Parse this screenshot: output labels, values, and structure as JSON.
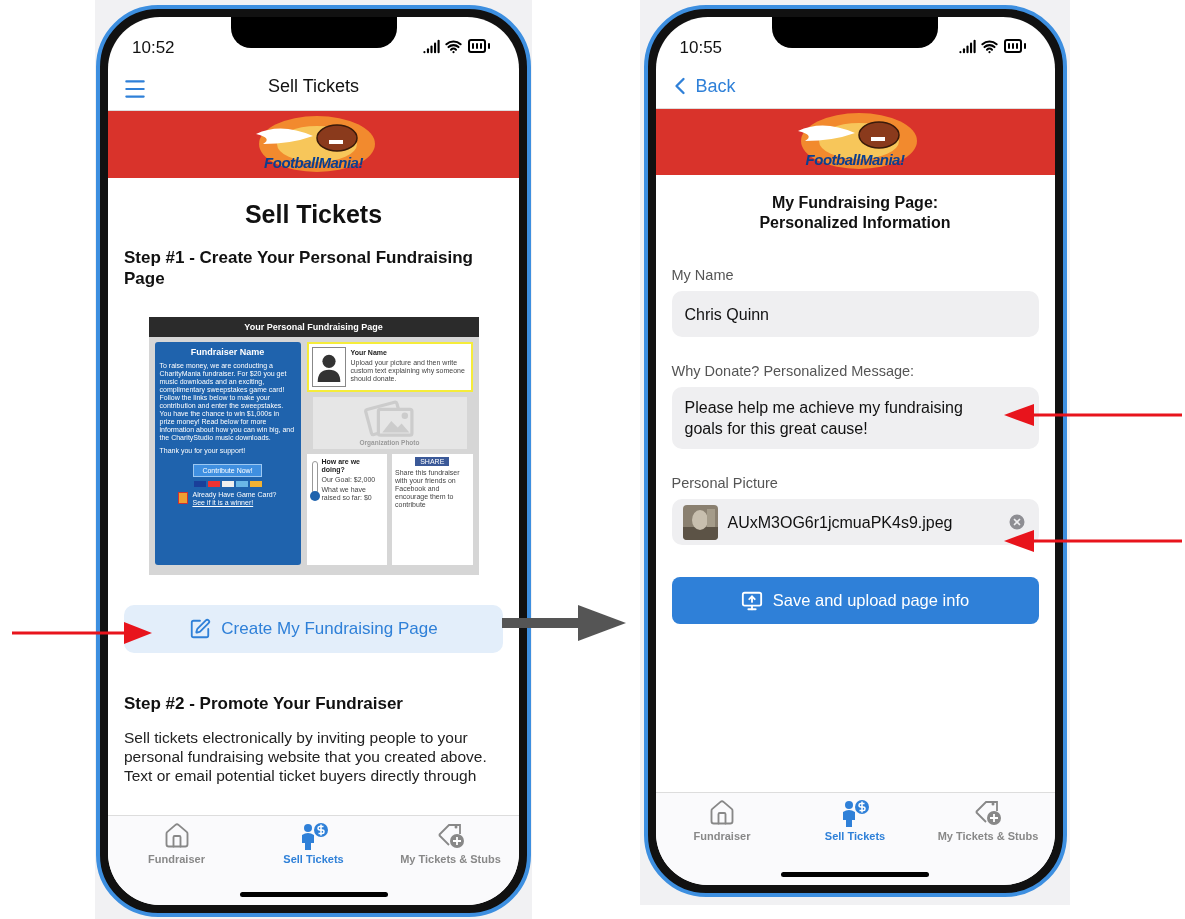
{
  "left_phone": {
    "status_bar": {
      "time": "10:52"
    },
    "nav": {
      "title": "Sell Tickets"
    },
    "banner": {
      "wordmark": "FootballMania!"
    },
    "heading": "Sell Tickets",
    "step1_title": "Step #1 - Create Your Personal Fundraising Page",
    "preview": {
      "title": "Your Personal Fundraising Page",
      "fundraiser_name": "Fundraiser Name",
      "intro": "To raise money, we are conducting a CharityMania fundraiser. For $20 you get music downloads and an exciting, complimentary sweepstakes game card! Follow the links below to make your contribution and enter the sweepstakes. You have the chance to win $1,000s in prize money! Read below for more information about how you can win big, and the CharityStudio music downloads.",
      "thanks": "Thank you for your support!",
      "contribute_button": "Contribute Now!",
      "game_card_question": "Already Have Game Card?",
      "game_card_link": "See if it is a winner!",
      "your_name": "Your Name",
      "your_name_hint": "Upload your picture and then write custom text explaining why someone should donate.",
      "org_photo": "Organization Photo",
      "progress_title": "How are we doing?",
      "goal": "Our Goal: $2,000",
      "raised": "What we have raised so far: $0",
      "share_button": "SHARE",
      "share_text": "Share this fundraiser with your friends on Facebook and encourage them to contribute"
    },
    "create_button": "Create My Fundraising Page",
    "step2_title": "Step #2 - Promote Your Fundraiser",
    "step2_text": "Sell tickets electronically by inviting people to your personal fundraising website that you created above. Text or email potential ticket buyers directly through",
    "tabs": [
      {
        "kind": "home",
        "label": "Fundraiser",
        "selected": false
      },
      {
        "kind": "seller",
        "label": "Sell Tickets",
        "selected": true
      },
      {
        "kind": "tag",
        "label": "My Tickets & Stubs",
        "selected": false
      }
    ]
  },
  "right_phone": {
    "status_bar": {
      "time": "10:55"
    },
    "nav": {
      "back": "Back"
    },
    "banner": {
      "wordmark": "FootballMania!"
    },
    "title": [
      "My Fundraising Page:",
      "Personalized Information"
    ],
    "fields": [
      {
        "kind": "text",
        "label": "My Name",
        "value": "Chris Quinn"
      },
      {
        "kind": "text",
        "label": "Why Donate? Personalized Message:",
        "value": "Please help me achieve my fundraising goals for this great cause!"
      },
      {
        "kind": "file",
        "label": "Personal Picture",
        "value": "AUxM3OG6r1jcmuaPK4s9.jpeg"
      }
    ],
    "save_button": "Save and upload page info",
    "tabs": [
      {
        "kind": "home",
        "label": "Fundraiser",
        "selected": false
      },
      {
        "kind": "seller",
        "label": "Sell Tickets",
        "selected": true
      },
      {
        "kind": "tag",
        "label": "My Tickets & Stubs",
        "selected": false
      }
    ]
  }
}
